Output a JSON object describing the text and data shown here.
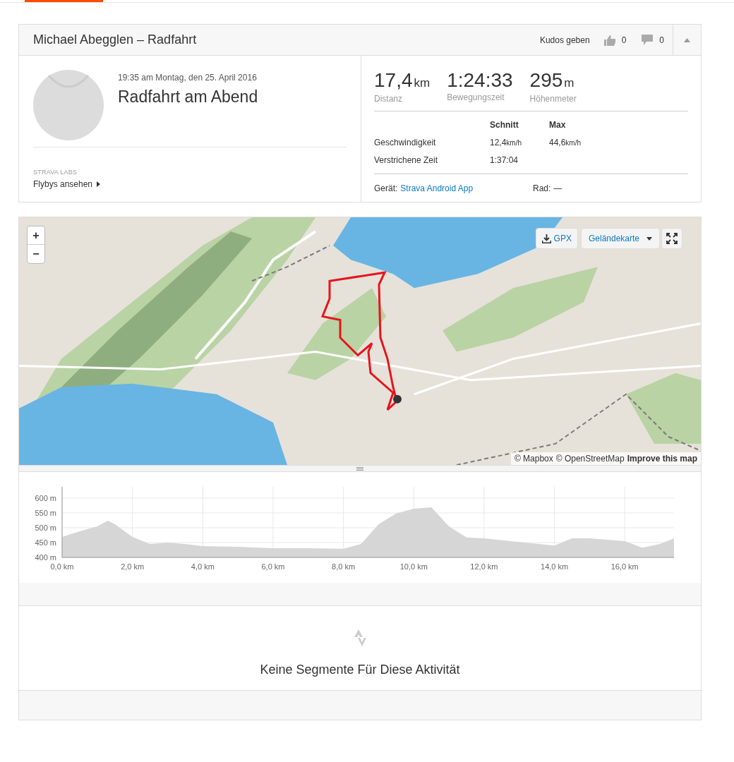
{
  "header": {
    "title": "Michael Abegglen – Radfahrt",
    "kudos_label": "Kudos geben",
    "kudos_count": "0",
    "comment_count": "0"
  },
  "activity": {
    "datetime": "19:35 am Montag, den 25. April 2016",
    "name": "Radfahrt am Abend",
    "labs_label": "STRAVA LABS",
    "flybys_link": "Flybys ansehen"
  },
  "stats": [
    {
      "value": "17,4",
      "unit": "km",
      "label": "Distanz"
    },
    {
      "value": "1:24:33",
      "label": "Bewegungszeit"
    },
    {
      "value": "295",
      "unit": "m",
      "label": "Höhenmeter"
    }
  ],
  "stats_table": {
    "columns": [
      "Schnitt",
      "Max"
    ],
    "rows": [
      {
        "label": "Geschwindigkeit",
        "cells": [
          {
            "value": "12,4",
            "unit": "km/h"
          },
          {
            "value": "44,6",
            "unit": "km/h"
          }
        ]
      },
      {
        "label": "Verstrichene Zeit",
        "cells": [
          {
            "value": "1:37:04"
          }
        ]
      }
    ]
  },
  "device": {
    "label": "Gerät:",
    "link": "Strava Android App"
  },
  "bike": {
    "label": "Rad:",
    "value": "—"
  },
  "map": {
    "kind": "picture",
    "zoom_in": "+",
    "zoom_out": "−",
    "gpx_button": "GPX",
    "layer_select": "Geländekarte",
    "attribution": [
      "© Mapbox",
      "© OpenStreetMap"
    ],
    "improve_link": "Improve this map"
  },
  "elevation": {
    "chart_data": {
      "type": "area",
      "x": [
        0,
        0.5,
        1,
        1.3,
        1.5,
        2,
        2.5,
        3,
        3.5,
        4,
        5,
        6,
        7,
        8,
        8.5,
        9,
        9.5,
        10,
        10.5,
        11,
        11.5,
        12,
        13,
        14,
        14.5,
        15,
        16,
        16.5,
        17,
        17.4
      ],
      "grid": true,
      "series": [
        {
          "color": "#d6d6d6",
          "values": [
            469,
            488,
            505,
            524,
            512,
            469,
            445,
            450,
            445,
            438,
            436,
            431,
            431,
            429,
            445,
            512,
            548,
            564,
            569,
            505,
            467,
            464,
            452,
            440,
            464,
            464,
            455,
            433,
            445,
            464
          ]
        }
      ],
      "xlim": [
        0,
        17.4
      ],
      "ylim": [
        400,
        600
      ],
      "xticks": [
        {
          "value": 0,
          "label": "0,0 km"
        },
        {
          "value": 2,
          "label": "2,0 km"
        },
        {
          "value": 4,
          "label": "4,0 km"
        },
        {
          "value": 6,
          "label": "6,0 km"
        },
        {
          "value": 8,
          "label": "8,0 km"
        },
        {
          "value": 10,
          "label": "10,0 km"
        },
        {
          "value": 12,
          "label": "12,0 km"
        },
        {
          "value": 14,
          "label": "14,0 km"
        },
        {
          "value": 16,
          "label": "16,0 km"
        }
      ],
      "yticks": [
        {
          "value": 400,
          "label": "400 m"
        },
        {
          "value": 450,
          "label": "450 m"
        },
        {
          "value": 500,
          "label": "500 m"
        },
        {
          "value": 550,
          "label": "550 m"
        },
        {
          "value": 600,
          "label": "600 m"
        }
      ]
    }
  },
  "segments": {
    "message": "Keine Segmente Für Diese Aktivität"
  }
}
